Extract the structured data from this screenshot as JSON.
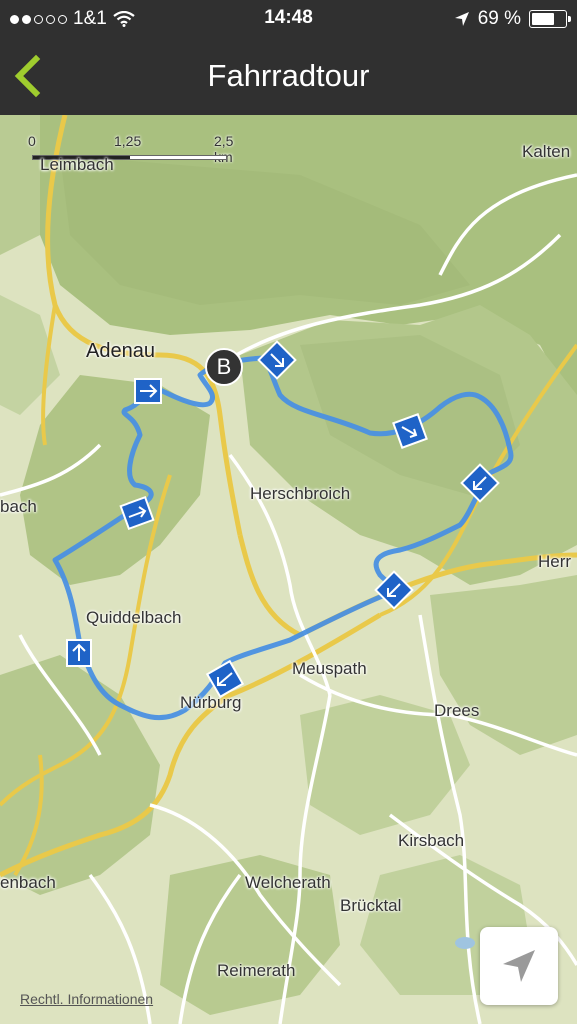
{
  "status": {
    "carrier": "1&1",
    "time": "14:48",
    "battery": "69 %",
    "signal_dots_filled": 2,
    "signal_dots_total": 5,
    "battery_level": 0.69
  },
  "nav": {
    "title": "Fahrradtour",
    "back_icon": "chevron-left-icon"
  },
  "map": {
    "scale": {
      "labels": [
        "0",
        "1,25",
        "2,5 km"
      ]
    },
    "places": {
      "leimbach": "Leimbach",
      "kalten": "Kalten",
      "adenau": "Adenau",
      "herschbroich": "Herschbroich",
      "bach": "bach",
      "herr": "Herr",
      "quiddelbach": "Quiddelbach",
      "meuspath": "Meuspath",
      "nurburg": "Nürburg",
      "drees": "Drees",
      "kirsbach": "Kirsbach",
      "enbach": "enbach",
      "welcherath": "Welcherath",
      "brucktal": "Brücktal",
      "reimerath": "Reimerath"
    },
    "start_marker": "B",
    "route_color": "#4a90e2",
    "direction_icon": "direction-arrow-icon"
  },
  "legal": "Rechtl. Informationen",
  "locate_icon": "location-arrow-icon",
  "colors": {
    "accent": "#9fcc2e",
    "bar": "#303030"
  }
}
